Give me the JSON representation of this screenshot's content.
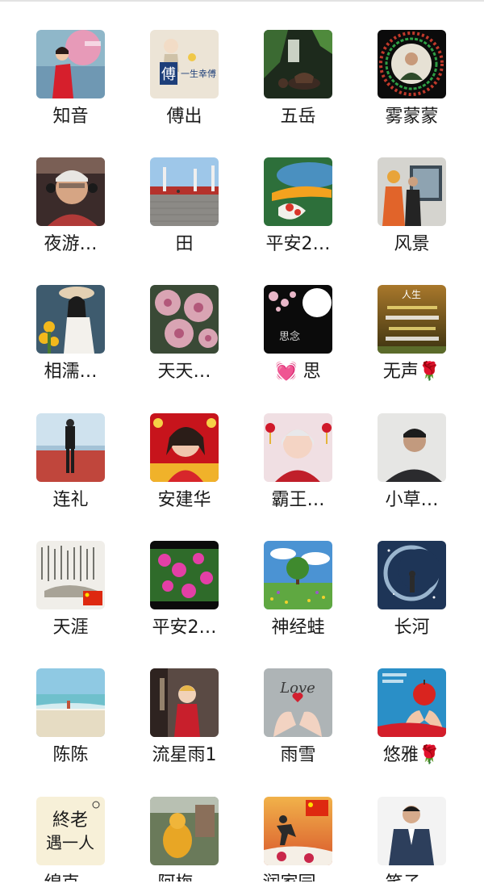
{
  "members": [
    {
      "name": "知音",
      "avatar": "woman-red-dress-umbrella"
    },
    {
      "name": "傅出",
      "avatar": "calligraphy-fu-logo"
    },
    {
      "name": "五岳",
      "avatar": "tea-set-bamboo"
    },
    {
      "name": "雾蒙蒙",
      "avatar": "man-floral-frame"
    },
    {
      "name": "夜游…",
      "avatar": "man-headphones"
    },
    {
      "name": "田",
      "avatar": "plaza-stairs"
    },
    {
      "name": "平安2…",
      "avatar": "koi-fish"
    },
    {
      "name": "风景",
      "avatar": "two-men-office"
    },
    {
      "name": "相濡…",
      "avatar": "woman-sunflowers"
    },
    {
      "name": "天天…",
      "avatar": "pink-flowers"
    },
    {
      "name": "💓 思",
      "avatar": "moon-blossoms-si-nian"
    },
    {
      "name": "无声🌹",
      "avatar": "golden-poem-text"
    },
    {
      "name": "连礼",
      "avatar": "man-red-dock"
    },
    {
      "name": "安建华",
      "avatar": "woman-festive-red"
    },
    {
      "name": "霸王…",
      "avatar": "woman-lanterns"
    },
    {
      "name": "小草…",
      "avatar": "man-portrait"
    },
    {
      "name": "天涯",
      "avatar": "calligraphy-scroll-flag"
    },
    {
      "name": "平安2…",
      "avatar": "magenta-flowers"
    },
    {
      "name": "神经蛙",
      "avatar": "tree-meadow"
    },
    {
      "name": "长河",
      "avatar": "moon-night-figure"
    },
    {
      "name": "陈陈",
      "avatar": "beach-sea"
    },
    {
      "name": "流星雨1",
      "avatar": "girl-red-coat"
    },
    {
      "name": "雨雪",
      "avatar": "hands-love-heart"
    },
    {
      "name": "悠雅🌹",
      "avatar": "hands-red-apple"
    },
    {
      "name": "绵克…",
      "avatar": "calligraphy-text"
    },
    {
      "name": "阿梅…",
      "avatar": "orange-cat"
    },
    {
      "name": "润家园…",
      "avatar": "taichi-sunset-flag"
    },
    {
      "name": "笑子…",
      "avatar": "man-suit"
    }
  ]
}
